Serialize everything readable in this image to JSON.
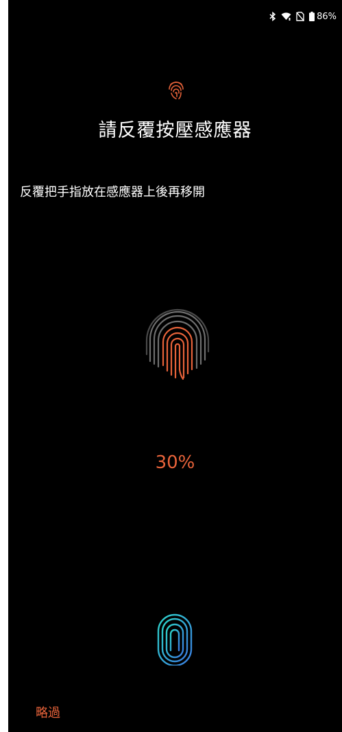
{
  "status_bar": {
    "battery_text": "86%",
    "icons": [
      "bluetooth-icon",
      "wifi-icon",
      "no-sim-icon",
      "battery-icon"
    ]
  },
  "enrollment": {
    "title": "請反覆按壓感應器",
    "instruction": "反覆把手指放在感應器上後再移開",
    "progress_text": "30%",
    "progress_value": 30,
    "skip_label": "略過"
  },
  "colors": {
    "background": "#000000",
    "accent_orange": "#e8633a",
    "fingerprint_gray": "#6f6f6f",
    "sensor_cyan": "#2dd4c8",
    "sensor_blue": "#3a7be0"
  }
}
